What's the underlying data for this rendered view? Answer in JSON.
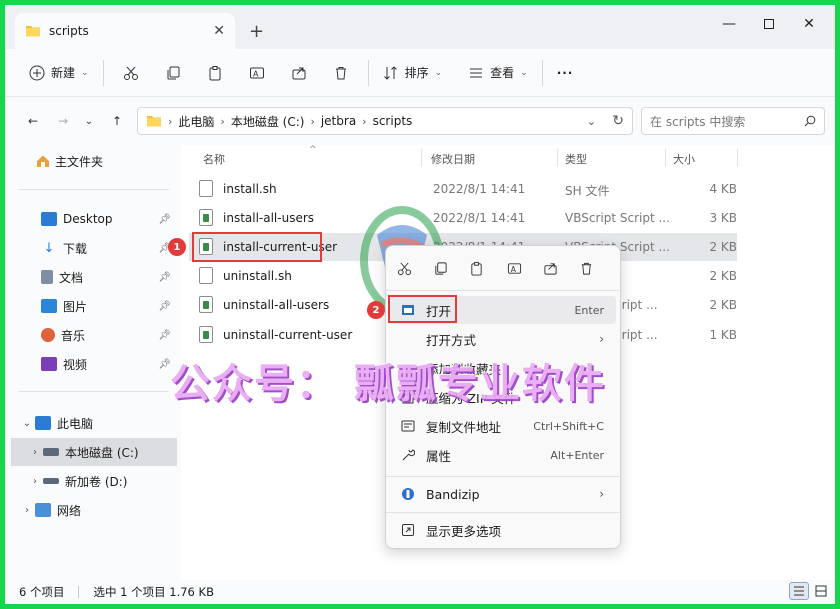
{
  "tab": {
    "title": "scripts"
  },
  "toolbar": {
    "new_label": "新建",
    "sort_label": "排序",
    "view_label": "查看",
    "more_label": "···"
  },
  "breadcrumb": [
    "此电脑",
    "本地磁盘 (C:)",
    "jetbra",
    "scripts"
  ],
  "search": {
    "placeholder": "在 scripts 中搜索"
  },
  "sidebar": {
    "home": "主文件夹",
    "quick": [
      {
        "label": "Desktop",
        "icon": "desktop-icon"
      },
      {
        "label": "下载",
        "icon": "download-icon"
      },
      {
        "label": "文档",
        "icon": "document-icon"
      },
      {
        "label": "图片",
        "icon": "pictures-icon"
      },
      {
        "label": "音乐",
        "icon": "music-icon"
      },
      {
        "label": "视频",
        "icon": "video-icon"
      }
    ],
    "this_pc": "此电脑",
    "drives": [
      {
        "label": "本地磁盘 (C:)"
      },
      {
        "label": "新加卷 (D:)"
      }
    ],
    "network": "网络"
  },
  "columns": {
    "name": "名称",
    "date": "修改日期",
    "type": "类型",
    "size": "大小"
  },
  "files": [
    {
      "name": "install.sh",
      "date": "2022/8/1 14:41",
      "type": "SH 文件",
      "size": "4 KB",
      "kind": "sh"
    },
    {
      "name": "install-all-users",
      "date": "2022/8/1 14:41",
      "type": "VBScript Script ...",
      "size": "3 KB",
      "kind": "vbs"
    },
    {
      "name": "install-current-user",
      "date": "2022/8/1 14:41",
      "type": "VBScript Script ...",
      "size": "2 KB",
      "kind": "vbs"
    },
    {
      "name": "uninstall.sh",
      "date": "",
      "type": "",
      "size": "2 KB",
      "kind": "sh"
    },
    {
      "name": "uninstall-all-users",
      "date": "",
      "type": "...cript Script ...",
      "size": "2 KB",
      "kind": "vbs"
    },
    {
      "name": "uninstall-current-user",
      "date": "",
      "type": "...cript Script ...",
      "size": "1 KB",
      "kind": "vbs"
    }
  ],
  "context_menu": {
    "items": [
      {
        "label": "打开",
        "shortcut": "Enter",
        "icon": "open-icon"
      },
      {
        "label": "打开方式",
        "shortcut": "",
        "icon": "open-with-icon",
        "submenu": true
      },
      {
        "label": "添加到收藏夹",
        "shortcut": "",
        "icon": "star-icon"
      },
      {
        "label": "压缩为 ZIP 文件",
        "shortcut": "",
        "icon": "zip-icon"
      },
      {
        "label": "复制文件地址",
        "shortcut": "Ctrl+Shift+C",
        "icon": "copy-path-icon"
      },
      {
        "label": "属性",
        "shortcut": "Alt+Enter",
        "icon": "properties-icon"
      },
      {
        "label": "Bandizip",
        "shortcut": "",
        "icon": "bandizip-icon",
        "submenu": true
      },
      {
        "label": "显示更多选项",
        "shortcut": "",
        "icon": "more-options-icon"
      }
    ]
  },
  "badges": {
    "step1": "1",
    "step2": "2"
  },
  "watermark": "公众号：  瓢瓢专业软件",
  "status": {
    "count": "6 个项目",
    "selection": "选中 1 个项目  1.76 KB"
  },
  "colors": {
    "accent": "#0067c0",
    "annotation": "#e23b3b",
    "frame": "#16d64c"
  }
}
